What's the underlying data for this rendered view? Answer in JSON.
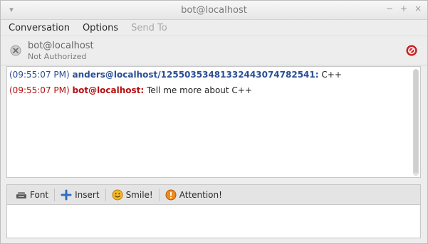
{
  "window": {
    "title": "bot@localhost",
    "controls": [
      "−",
      "+",
      "×"
    ]
  },
  "menubar": {
    "items": [
      {
        "label": "Conversation",
        "enabled": true
      },
      {
        "label": "Options",
        "enabled": true
      },
      {
        "label": "Send To",
        "enabled": false
      }
    ]
  },
  "header": {
    "name": "bot@localhost",
    "status": "Not Authorized"
  },
  "messages": [
    {
      "time": "(09:55:07 PM)",
      "sender": "anders@localhost/1255035348133244307478254​1:",
      "text": "C++",
      "color": "#2a4e96"
    },
    {
      "time": "(09:55:07 PM)",
      "sender": "bot@localhost:",
      "text": "Tell me more about C++",
      "color": "#b40f0f"
    }
  ],
  "toolbar": {
    "font_label": "Font",
    "insert_label": "Insert",
    "smile_label": "Smile!",
    "attention_label": "Attention!"
  },
  "colors": {
    "blue": "#2a4e96",
    "red": "#b40f0f"
  }
}
